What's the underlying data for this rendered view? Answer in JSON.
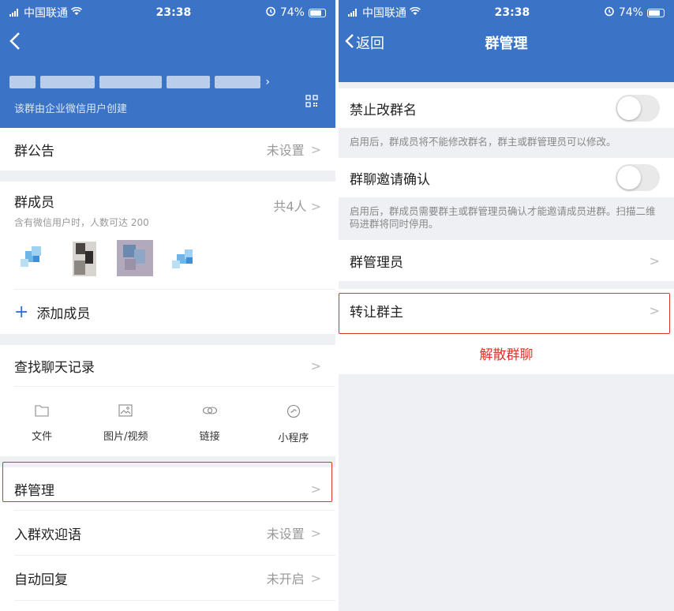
{
  "colors": {
    "header_blue": "#3b74c7",
    "accent_blue": "#2f6fd6",
    "danger_red": "#e0332b",
    "highlight_red": "#e0332b"
  },
  "status_bar": {
    "carrier": "中国联通",
    "time": "23:38",
    "battery": "74%"
  },
  "left": {
    "header": {
      "creator_note": "该群由企业微信用户创建"
    },
    "announcement": {
      "label": "群公告",
      "value": "未设置"
    },
    "members": {
      "label": "群成员",
      "subtitle": "含有微信用户时，人数可达 200",
      "count": "共4人"
    },
    "add_member": {
      "label": "添加成员"
    },
    "search_history": {
      "label": "查找聊天记录"
    },
    "media": [
      {
        "icon": "folder-icon",
        "label": "文件"
      },
      {
        "icon": "image-icon",
        "label": "图片/视频"
      },
      {
        "icon": "link-icon",
        "label": "链接"
      },
      {
        "icon": "mini-program-icon",
        "label": "小程序"
      }
    ],
    "group_manage": {
      "label": "群管理"
    },
    "welcome": {
      "label": "入群欢迎语",
      "value": "未设置"
    },
    "auto_reply": {
      "label": "自动回复",
      "value": "未开启"
    }
  },
  "right": {
    "nav": {
      "back_label": "返回",
      "title": "群管理"
    },
    "forbid_rename": {
      "label": "禁止改群名",
      "enabled": false,
      "note": "启用后，群成员将不能修改群名，群主或群管理员可以修改。"
    },
    "invite_confirm": {
      "label": "群聊邀请确认",
      "enabled": false,
      "note": "启用后，群成员需要群主或群管理员确认才能邀请成员进群。扫描二维码进群将同时停用。"
    },
    "admins": {
      "label": "群管理员"
    },
    "transfer_owner": {
      "label": "转让群主"
    },
    "dissolve": {
      "label": "解散群聊"
    }
  }
}
